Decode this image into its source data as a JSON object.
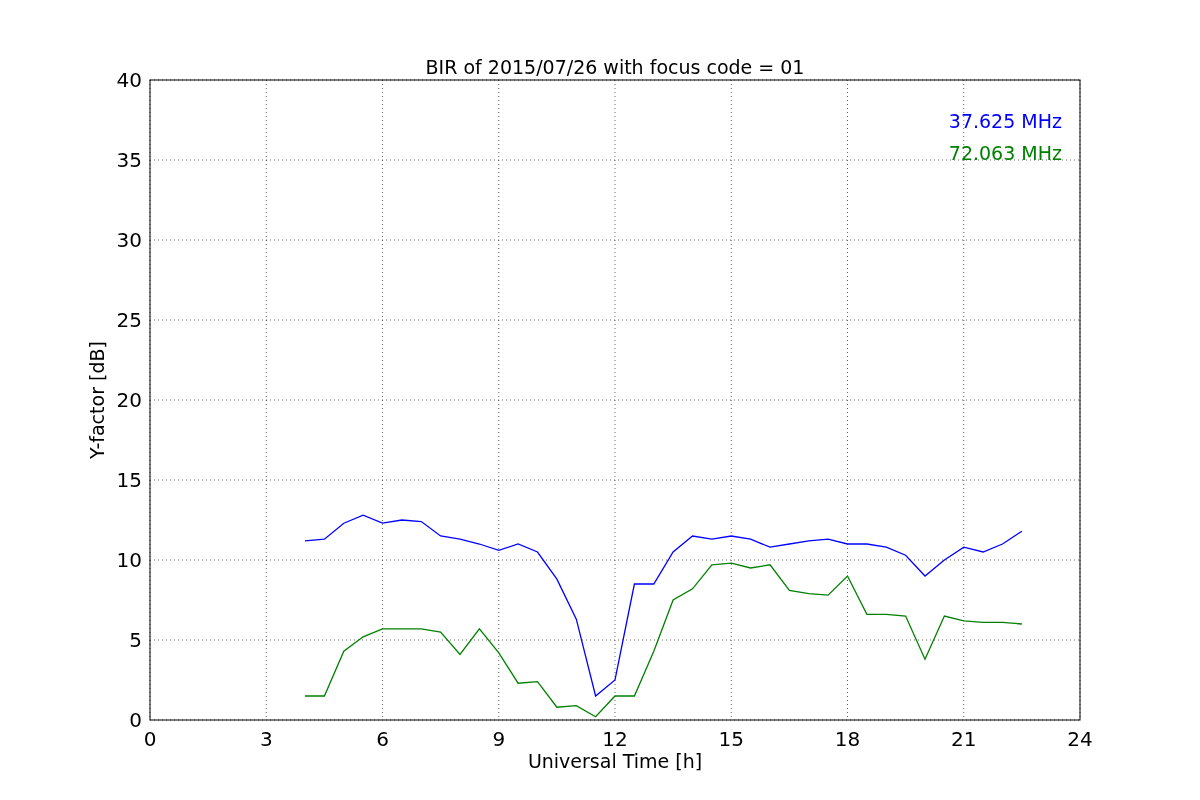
{
  "chart_data": {
    "type": "line",
    "title": "BIR of 2015/07/26 with focus code = 01",
    "xlabel": "Universal Time [h]",
    "ylabel": "Y-factor [dB]",
    "x": [
      4,
      4.5,
      5,
      5.5,
      6,
      6.5,
      7,
      7.5,
      8,
      8.5,
      9,
      9.5,
      10,
      10.5,
      11,
      11.5,
      12,
      12.5,
      13,
      13.5,
      14,
      14.5,
      15,
      15.5,
      16,
      16.5,
      17,
      17.5,
      18,
      18.5,
      19,
      19.5,
      20,
      20.5,
      21,
      21.5,
      22,
      22.5
    ],
    "series": [
      {
        "name": "37.625 MHz",
        "color": "#0000ff",
        "values": [
          11.2,
          11.3,
          12.3,
          12.8,
          12.3,
          12.5,
          12.4,
          11.5,
          11.3,
          11.0,
          10.6,
          11.0,
          10.5,
          8.8,
          6.3,
          1.5,
          2.5,
          8.5,
          8.5,
          10.5,
          11.5,
          11.3,
          11.5,
          11.3,
          10.8,
          11.0,
          11.2,
          11.3,
          11.0,
          11.0,
          10.8,
          10.3,
          9.0,
          10.0,
          10.8,
          10.5,
          11.0,
          11.8
        ]
      },
      {
        "name": "72.063 MHz",
        "color": "#008000",
        "values": [
          1.5,
          1.5,
          4.3,
          5.2,
          5.7,
          5.7,
          5.7,
          5.5,
          4.1,
          5.7,
          4.2,
          2.3,
          2.4,
          0.8,
          0.9,
          0.2,
          1.5,
          1.5,
          4.3,
          7.5,
          8.2,
          9.7,
          9.8,
          9.5,
          9.7,
          8.1,
          7.9,
          7.8,
          9.0,
          6.6,
          6.6,
          6.5,
          3.8,
          6.5,
          6.2,
          6.1,
          6.1,
          6.0
        ]
      }
    ],
    "xlim": [
      0,
      24
    ],
    "ylim": [
      0,
      40
    ],
    "xticks": [
      0,
      3,
      6,
      9,
      12,
      15,
      18,
      21,
      24
    ],
    "yticks": [
      0,
      5,
      10,
      15,
      20,
      25,
      30,
      35,
      40
    ],
    "grid": true
  }
}
